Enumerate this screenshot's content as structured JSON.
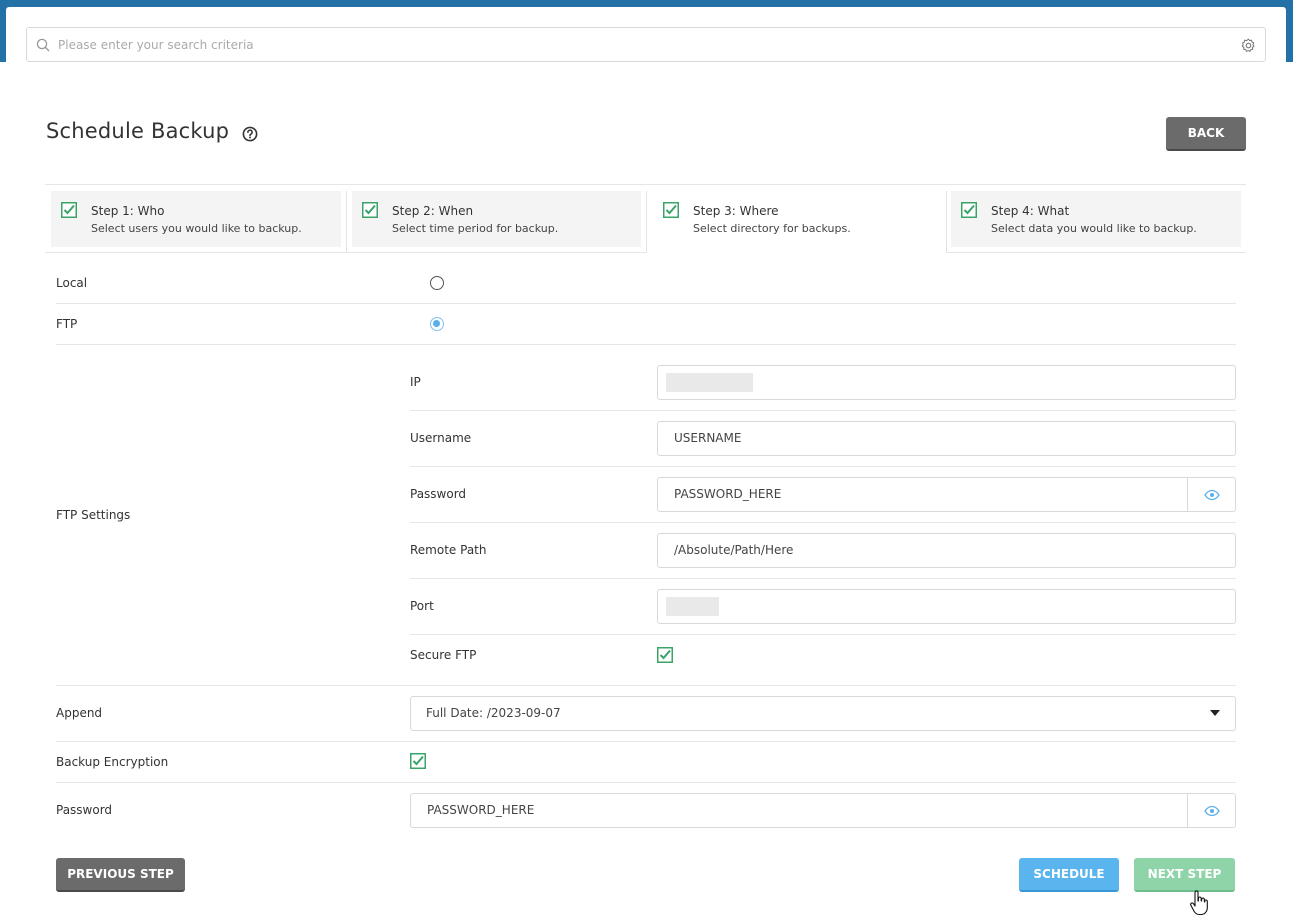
{
  "search": {
    "placeholder": "Please enter your search criteria"
  },
  "page": {
    "title": "Schedule Backup",
    "back_label": "BACK"
  },
  "steps": [
    {
      "title": "Step 1: Who",
      "desc": "Select users you would like to backup.",
      "checked": true
    },
    {
      "title": "Step 2: When",
      "desc": "Select time period for backup.",
      "checked": true
    },
    {
      "title": "Step 3: Where",
      "desc": "Select directory for backups.",
      "checked": true,
      "active": true
    },
    {
      "title": "Step 4: What",
      "desc": "Select data you would like to backup.",
      "checked": true
    }
  ],
  "destination": {
    "local_label": "Local",
    "ftp_label": "FTP",
    "selected": "FTP"
  },
  "ftp": {
    "section_label": "FTP Settings",
    "ip_label": "IP",
    "ip_value": "",
    "username_label": "Username",
    "username_value": "USERNAME",
    "password_label": "Password",
    "password_value": "PASSWORD_HERE",
    "remote_path_label": "Remote Path",
    "remote_path_value": "/Absolute/Path/Here",
    "port_label": "Port",
    "port_value": "",
    "secure_label": "Secure FTP",
    "secure_checked": true
  },
  "append": {
    "label": "Append",
    "value": "Full Date: /2023-09-07"
  },
  "encryption": {
    "label": "Backup Encryption",
    "checked": true,
    "password_label": "Password",
    "password_value": "PASSWORD_HERE"
  },
  "footer": {
    "prev_label": "PREVIOUS STEP",
    "schedule_label": "SCHEDULE",
    "next_label": "NEXT STEP"
  },
  "colors": {
    "header": "#2471a8",
    "check": "#3aa36a",
    "radio": "#5aafea",
    "schedule": "#5ab4ee",
    "next": "#8fd4a9",
    "dark_btn": "#6b6b6b"
  }
}
